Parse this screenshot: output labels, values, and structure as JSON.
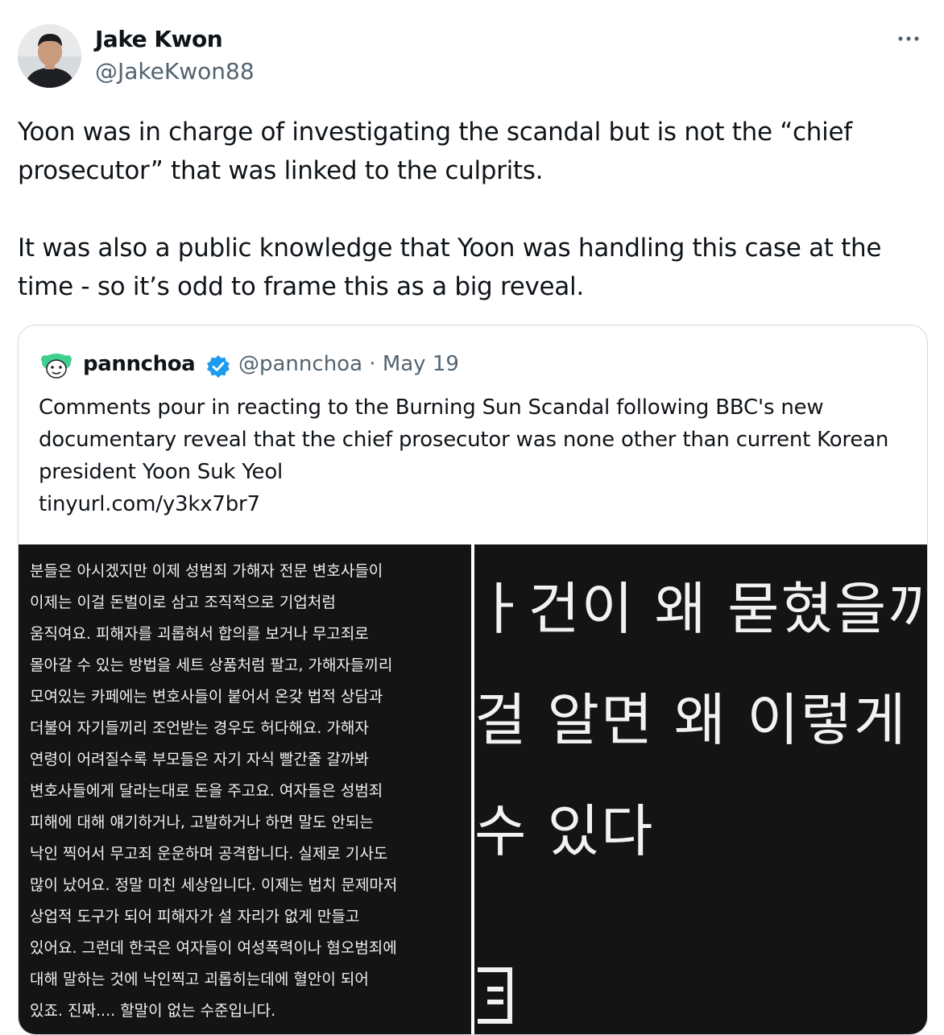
{
  "tweet": {
    "author_name": "Jake Kwon",
    "author_handle": "@JakeKwon88",
    "more_icon": "more-horizontal-icon",
    "text": "Yoon was in charge of investigating the scandal but is not the “chief prosecutor” that was linked to the culprits.\n\nIt was also a public knowledge that Yoon was handling this case at the time - so it’s odd to frame this as a big reveal."
  },
  "quoted_tweet": {
    "author_name": "pannchoa",
    "verified_icon": "verified-badge-icon",
    "author_handle": "@pannchoa",
    "separator": "·",
    "date": "May 19",
    "text": "Comments pour in reacting to the Burning Sun Scandal following BBC's new documentary reveal that the chief prosecutor was none other than current Korean president Yoon Suk Yeol",
    "link": "tinyurl.com/y3kx7br7",
    "media_left_lines": [
      "분들은 아시겠지만 이제 성범죄 가해자 전문 변호사들이",
      "이제는 이걸 돈벌이로 삼고 조직적으로 기업처럼",
      "움직여요. 피해자를 괴롭혀서 합의를 보거나 무고죄로",
      "몰아갈 수 있는 방법을 세트 상품처럼 팔고, 가해자들끼리",
      "모여있는 카페에는 변호사들이 붙어서 온갖 법적 상담과",
      "더불어 자기들끼리 조언받는 경우도 허다해요. 가해자",
      "연령이 어려질수록 부모들은 자기 자식 빨간줄 갈까봐",
      "변호사들에게 달라는대로 돈을 주고요. 여자들은 성범죄",
      "피해에 대해 얘기하거나, 고발하거나 하면 말도 안되는",
      "낙인 찍어서 무고죄 운운하며 공격합니다. 실제로 기사도",
      "많이 났어요. 정말 미친 세상입니다. 이제는 법치 문제마저",
      "상업적 도구가 되어 피해자가 설 자리가 없게 만들고",
      "있어요. 그런데 한국은 여자들이 여성폭력이나 혐오범죄에",
      "대해 말하는 것에 낙인찍고 괴롭히는데에 혈안이 되어",
      "있죠. 진짜.... 할말이 없는 수준입니다."
    ],
    "media_right_lines": [
      "ㅏ건이 왜 묻혔을끼",
      "걸 알면 왜 이렇게",
      "수 있다"
    ]
  }
}
